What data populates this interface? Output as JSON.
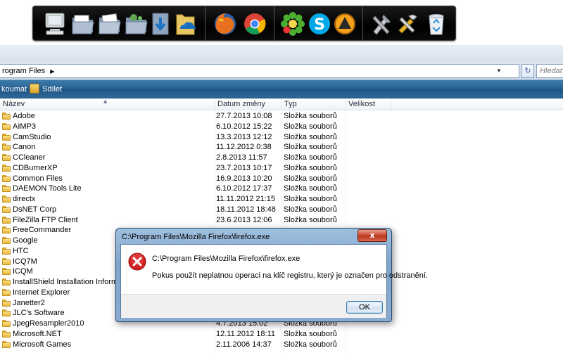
{
  "dock": {
    "icons": [
      {
        "name": "computer-icon"
      },
      {
        "name": "folder-open-icon"
      },
      {
        "name": "folder-pictures-icon"
      },
      {
        "name": "folder-network-icon"
      },
      {
        "name": "downloads-icon"
      },
      {
        "name": "onedrive-folder-icon"
      },
      {
        "name": "firefox-icon"
      },
      {
        "name": "chrome-icon"
      },
      {
        "name": "icq-icon"
      },
      {
        "name": "skype-icon"
      },
      {
        "name": "aimp-icon"
      },
      {
        "name": "tools-icon"
      },
      {
        "name": "settings-tools-icon"
      },
      {
        "name": "recycle-bin-icon"
      }
    ]
  },
  "address_bar": {
    "path": "rogram Files",
    "search_placeholder": "Hledat"
  },
  "toolbar": {
    "burn_label": "koumat",
    "share_label": "Sdílet"
  },
  "list_header": {
    "name": "Název",
    "date": "Datum změny",
    "type": "Typ",
    "size": "Velikost"
  },
  "files": [
    {
      "name": "Adobe",
      "date": "27.7.2013 10:08",
      "type": "Složka souborů"
    },
    {
      "name": "AIMP3",
      "date": "6.10.2012 15:22",
      "type": "Složka souborů"
    },
    {
      "name": "CamStudio",
      "date": "13.3.2013 12:12",
      "type": "Složka souborů"
    },
    {
      "name": "Canon",
      "date": "11.12.2012 0:38",
      "type": "Složka souborů"
    },
    {
      "name": "CCleaner",
      "date": "2.8.2013 11:57",
      "type": "Složka souborů"
    },
    {
      "name": "CDBurnerXP",
      "date": "23.7.2013 10:17",
      "type": "Složka souborů"
    },
    {
      "name": "Common Files",
      "date": "16.9.2013 10:20",
      "type": "Složka souborů"
    },
    {
      "name": "DAEMON Tools Lite",
      "date": "6.10.2012 17:37",
      "type": "Složka souborů"
    },
    {
      "name": "directx",
      "date": "11.11.2012 21:15",
      "type": "Složka souborů"
    },
    {
      "name": "DsNET Corp",
      "date": "18.11.2012 18:48",
      "type": "Složka souborů"
    },
    {
      "name": "FileZilla FTP Client",
      "date": "23.6.2013 12:06",
      "type": "Složka souborů"
    },
    {
      "name": "FreeCommander",
      "date": "",
      "type": ""
    },
    {
      "name": "Google",
      "date": "",
      "type": ""
    },
    {
      "name": "HTC",
      "date": "",
      "type": ""
    },
    {
      "name": "ICQ7M",
      "date": "",
      "type": ""
    },
    {
      "name": "ICQM",
      "date": "",
      "type": ""
    },
    {
      "name": "InstallShield Installation Information",
      "date": "",
      "type": ""
    },
    {
      "name": "Internet Explorer",
      "date": "",
      "type": ""
    },
    {
      "name": "Janetter2",
      "date": "",
      "type": ""
    },
    {
      "name": "JLC's Software",
      "date": "",
      "type": ""
    },
    {
      "name": "JpegResampler2010",
      "date": "4.7.2013 15:02",
      "type": "Složka souborů"
    },
    {
      "name": "Microsoft.NET",
      "date": "12.11.2012 18:11",
      "type": "Složka souborů"
    },
    {
      "name": "Microsoft Games",
      "date": "2.11.2006 14:37",
      "type": "Složka souborů"
    }
  ],
  "dialog": {
    "title": "C:\\Program Files\\Mozilla Firefox\\firefox.exe",
    "close_label": "x",
    "path": "C:\\Program Files\\Mozilla Firefox\\firefox.exe",
    "message": "Pokus použít neplatnou operaci na klíč registru, který je označen pro odstranění.",
    "ok_label": "OK"
  }
}
